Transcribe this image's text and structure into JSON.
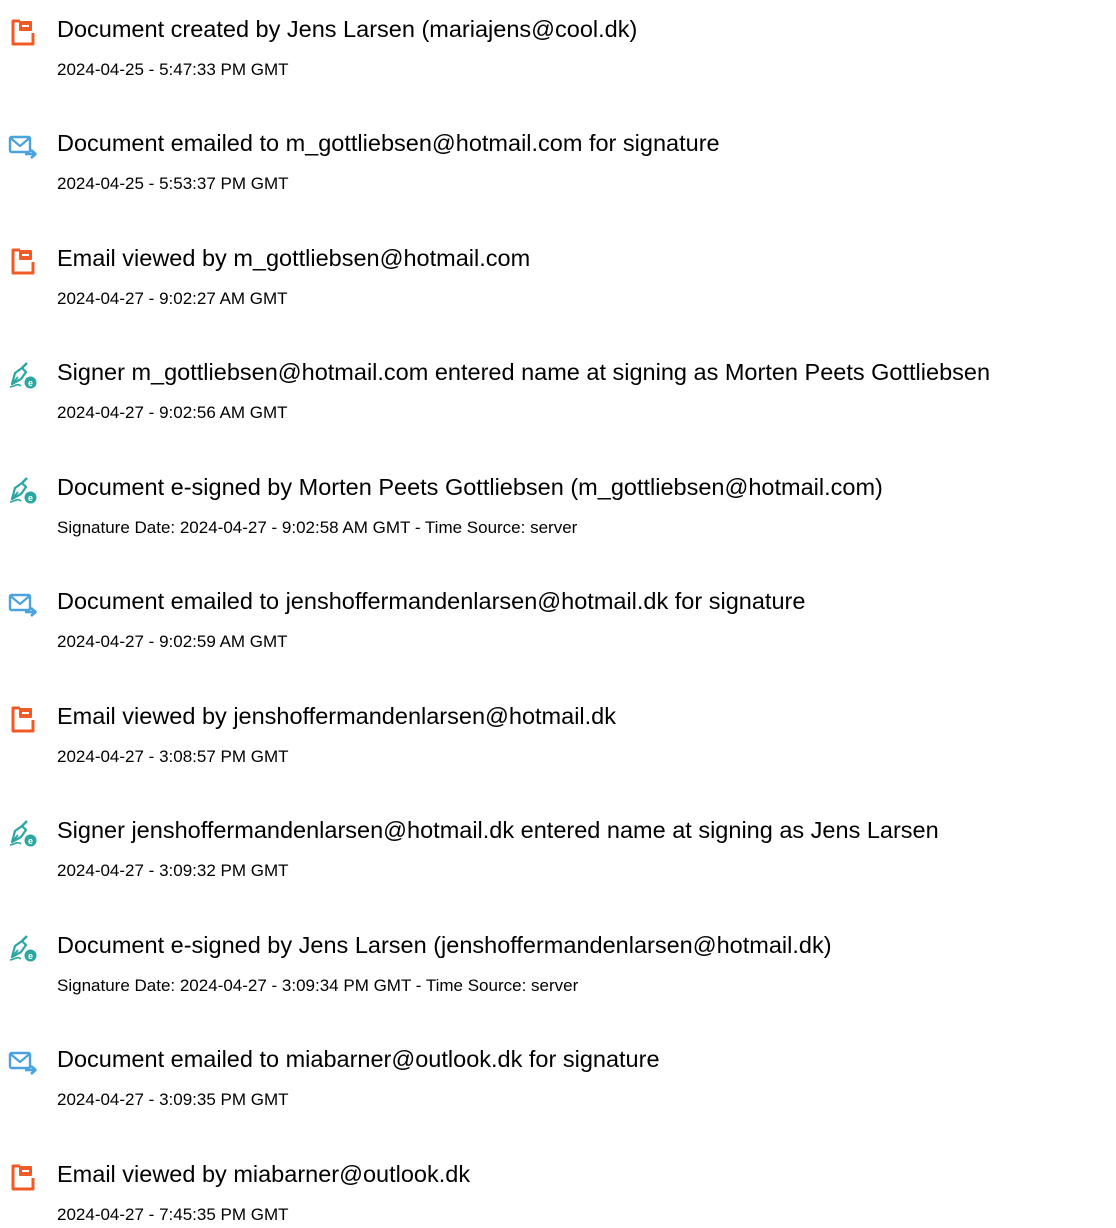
{
  "colors": {
    "doc_icon": "#f15a24",
    "email_icon": "#4aa3df",
    "sign_icon": "#2aa7a0",
    "text": "#000000"
  },
  "events": [
    {
      "icon": "document-icon",
      "title": "Document created by Jens Larsen (mariajens@cool.dk)",
      "meta": "2024-04-25 - 5:47:33 PM GMT"
    },
    {
      "icon": "email-icon",
      "title": "Document emailed to m_gottliebsen@hotmail.com for signature",
      "meta": "2024-04-25 - 5:53:37 PM GMT"
    },
    {
      "icon": "document-icon",
      "title": "Email viewed by m_gottliebsen@hotmail.com",
      "meta": "2024-04-27 - 9:02:27 AM GMT"
    },
    {
      "icon": "signature-icon",
      "title": "Signer m_gottliebsen@hotmail.com entered name at signing as Morten Peets Gottliebsen",
      "meta": "2024-04-27 - 9:02:56 AM GMT"
    },
    {
      "icon": "signature-icon",
      "title": "Document e-signed by Morten Peets Gottliebsen (m_gottliebsen@hotmail.com)",
      "meta": "Signature Date: 2024-04-27 - 9:02:58 AM GMT - Time Source: server"
    },
    {
      "icon": "email-icon",
      "title": "Document emailed to jenshoffermandenlarsen@hotmail.dk for signature",
      "meta": "2024-04-27 - 9:02:59 AM GMT"
    },
    {
      "icon": "document-icon",
      "title": "Email viewed by jenshoffermandenlarsen@hotmail.dk",
      "meta": "2024-04-27 - 3:08:57 PM GMT"
    },
    {
      "icon": "signature-icon",
      "title": "Signer jenshoffermandenlarsen@hotmail.dk entered name at signing as Jens Larsen",
      "meta": "2024-04-27 - 3:09:32 PM GMT"
    },
    {
      "icon": "signature-icon",
      "title": "Document e-signed by Jens Larsen (jenshoffermandenlarsen@hotmail.dk)",
      "meta": "Signature Date: 2024-04-27 - 3:09:34 PM GMT - Time Source: server"
    },
    {
      "icon": "email-icon",
      "title": "Document emailed to miabarner@outlook.dk for signature",
      "meta": "2024-04-27 - 3:09:35 PM GMT"
    },
    {
      "icon": "document-icon",
      "title": "Email viewed by miabarner@outlook.dk",
      "meta": "2024-04-27 - 7:45:35 PM GMT"
    }
  ]
}
